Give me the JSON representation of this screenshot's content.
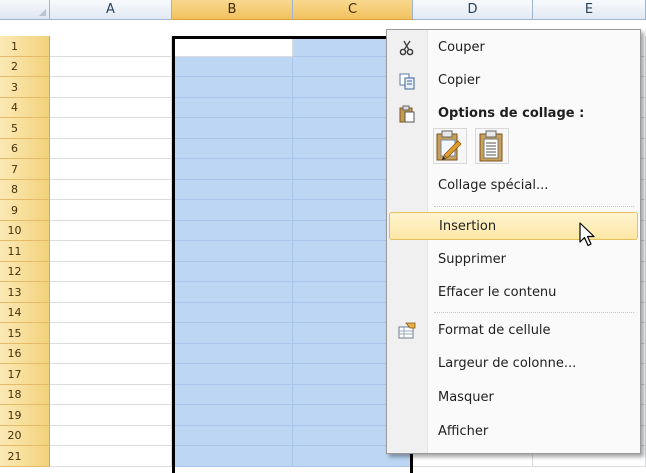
{
  "sheet": {
    "columns": [
      "A",
      "B",
      "C",
      "D",
      "E"
    ],
    "selected_columns": [
      "B",
      "C"
    ],
    "rows": [
      "1",
      "2",
      "3",
      "4",
      "5",
      "6",
      "7",
      "8",
      "9",
      "10",
      "11",
      "12",
      "13",
      "14",
      "15",
      "16",
      "17",
      "18",
      "19",
      "20",
      "21"
    ]
  },
  "context_menu": {
    "cut": "Couper",
    "copy": "Copier",
    "paste_options_header": "Options de collage :",
    "paste_options": [
      "paste-icon",
      "paste-values-icon"
    ],
    "paste_special": "Collage spécial...",
    "insert": "Insertion",
    "delete": "Supprimer",
    "clear_contents": "Effacer le contenu",
    "format_cells": "Format de cellule",
    "column_width": "Largeur de colonne...",
    "hide": "Masquer",
    "unhide": "Afficher"
  },
  "colors": {
    "selection": "#bcd6f4",
    "highlight": "#fde7a6",
    "row_header": "#f3d27c"
  }
}
